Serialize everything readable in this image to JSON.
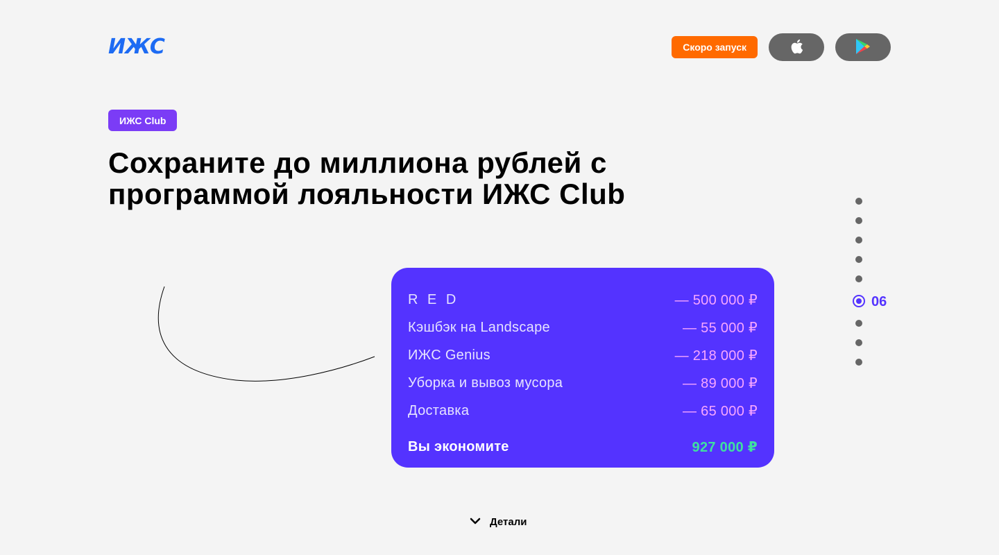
{
  "header": {
    "logo_text": "ИЖС",
    "launch_label": "Скоро запуск",
    "stores": [
      "apple-icon",
      "google-play-icon"
    ]
  },
  "badge": "ИЖС Club",
  "title_line1": "Сохраните до миллиона рублей с",
  "title_line2": "программой лояльности ИЖС Club",
  "savings": {
    "rows": [
      {
        "label": "R E D",
        "value": "— 500 000 ₽"
      },
      {
        "label": "Кэшбэк на Landscape",
        "value": "— 55 000 ₽"
      },
      {
        "label": "ИЖС Genius",
        "value": "— 218 000 ₽"
      },
      {
        "label": "Уборка и вывоз мусора",
        "value": "— 89 000 ₽"
      },
      {
        "label": "Доставка",
        "value": "— 65 000 ₽"
      }
    ],
    "total_label": "Вы экономите",
    "total_value": "927 000 ₽"
  },
  "pager": {
    "active_label": "06"
  },
  "details_label": "Детали",
  "colors": {
    "accent": "#5433ff",
    "orange": "#ff6a00",
    "badge": "#7b3cf6",
    "value_pink": "#f7a6ff",
    "total_green": "#3fe0a0"
  }
}
